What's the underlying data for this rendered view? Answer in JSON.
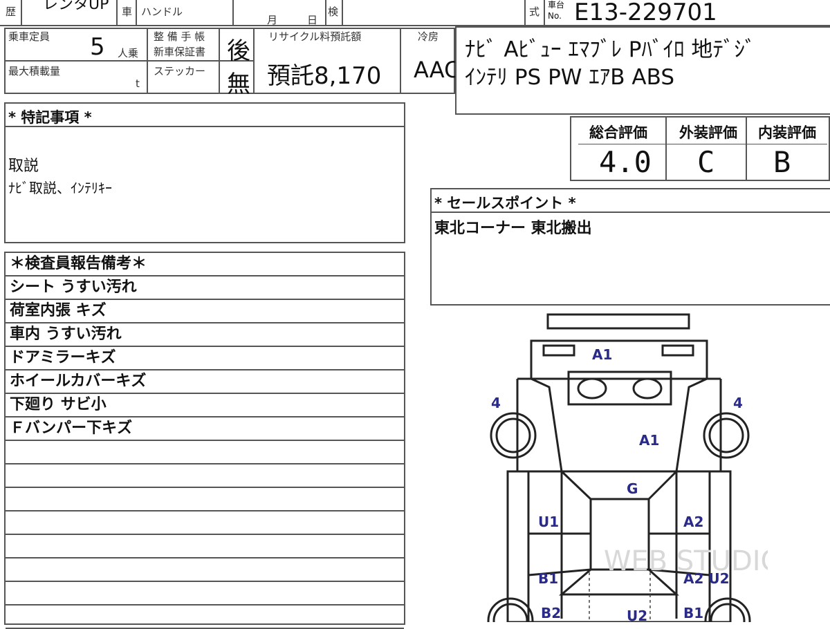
{
  "top_row": {
    "reki_label": "歴",
    "reki_value": "レンタUP",
    "sha_label": "車",
    "handle_label": "ハンドル",
    "month_label": "月",
    "day_label": "日",
    "ken_label": "検",
    "shiki_label": "式",
    "chassis_no_label_1": "車台",
    "chassis_no_label_2": "No.",
    "chassis_no": "E13-229701"
  },
  "specs": {
    "capacity_label": "乗車定員",
    "capacity_value": "5",
    "capacity_unit": "人乗",
    "max_load_label": "最大積載量",
    "max_load_unit": "t",
    "maintenance_label_1": "整 備 手 帳",
    "maintenance_label_2": "新車保証書",
    "maintenance_value": "後",
    "sticker_label": "ステッカー",
    "sticker_value": "無",
    "recycle_label": "リサイクル料預託額",
    "recycle_value": "預託8,170",
    "ac_label": "冷房",
    "ac_value": "AAC"
  },
  "equipment": {
    "line1": "ﾅﾋﾞ Aﾋﾞｭｰ ｴﾏﾌﾞﾚ Pﾊﾞｲﾛ 地ﾃﾞｼﾞ",
    "line2": "ｲﾝﾃﾘ PS PW ｴｱB ABS"
  },
  "ratings": {
    "overall_label": "総合評価",
    "overall_value": "4.0",
    "exterior_label": "外装評価",
    "exterior_value": "C",
    "interior_label": "内装評価",
    "interior_value": "B"
  },
  "special_notes": {
    "title": "* 特記事項 *",
    "line1": "取説",
    "line2": "ﾅﾋﾞ取説、ｲﾝﾃﾘｷｰ"
  },
  "sales_point": {
    "title": "* セールスポイント *",
    "text": "東北コーナー 東北搬出"
  },
  "inspector_report": {
    "title": "＊検査員報告備考＊",
    "items": [
      "シート うすい汚れ",
      "荷室内張 キズ",
      "車内 うすい汚れ",
      "ドアミラーキズ",
      "ホイールカバーキズ",
      "下廻り サビ小",
      "Ｆバンパー下キズ",
      "",
      "",
      "",
      "",
      "",
      "",
      "",
      ""
    ]
  },
  "damage_map": {
    "marks": [
      "A1",
      "4",
      "4",
      "A1",
      "G",
      "U1",
      "A2",
      "B1",
      "A2 U2",
      "B2",
      "U2",
      "B1"
    ],
    "watermark": "WEB STUDIO PRO"
  }
}
